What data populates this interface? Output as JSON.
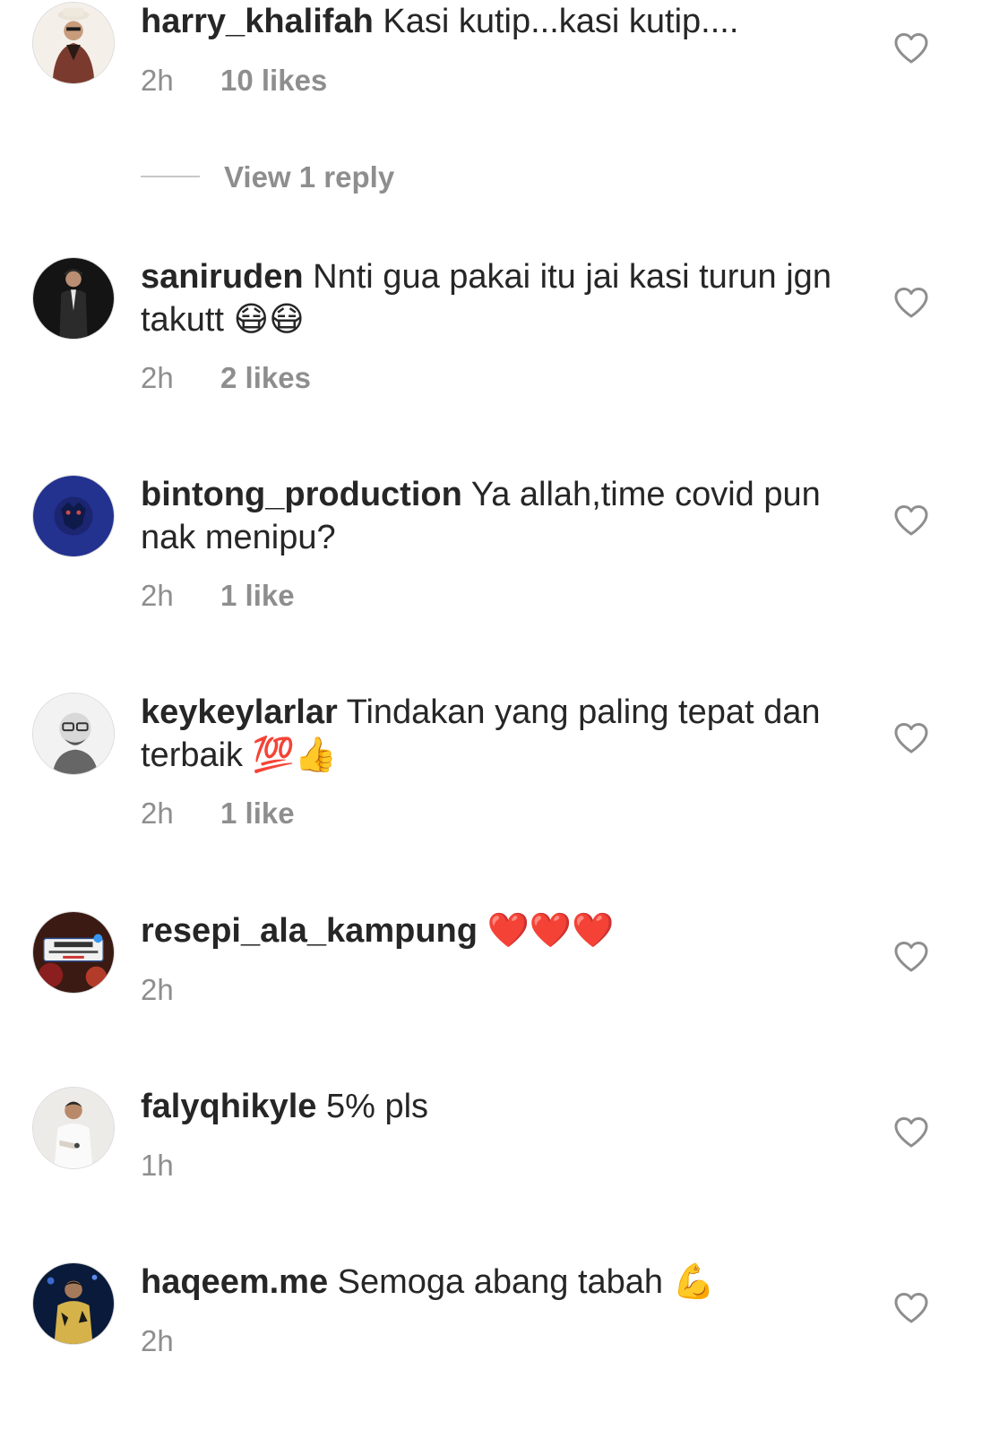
{
  "reply_link": {
    "label": "View 1 reply"
  },
  "comments": [
    {
      "username": "harry_khalifah",
      "text": "Kasi kutip...kasi kutip....",
      "time": "2h",
      "likes": "10 likes",
      "avatar_color": "#7a3b2e",
      "avatar_bg": "#f4efe9"
    },
    {
      "username": "saniruden",
      "text": "Nnti gua pakai itu jai kasi turun jgn takutt 😷😷",
      "time": "2h",
      "likes": "2 likes",
      "avatar_color": "#2b2b2b",
      "avatar_bg": "#111111"
    },
    {
      "username": "bintong_production",
      "text": "Ya allah,time covid pun nak menipu?",
      "time": "2h",
      "likes": "1 like",
      "avatar_color": "#1e3a8a",
      "avatar_bg": "#23318f"
    },
    {
      "username": "keykeylarlar",
      "text": "Tindakan yang paling tepat dan terbaik 💯👍",
      "time": "2h",
      "likes": "1 like",
      "avatar_color": "#444444",
      "avatar_bg": "#f2f2f2"
    },
    {
      "username": "resepi_ala_kampung",
      "text": "❤️❤️❤️",
      "time": "2h",
      "likes": "",
      "avatar_color": "#8b1e1e",
      "avatar_bg": "#3a1a12"
    },
    {
      "username": "falyqhikyle",
      "text": "5% pls",
      "time": "1h",
      "likes": "",
      "avatar_color": "#d9d2c8",
      "avatar_bg": "#ecebe8"
    },
    {
      "username": "haqeem.me",
      "text": "Semoga abang tabah 💪",
      "time": "2h",
      "likes": "",
      "avatar_color": "#d6b24a",
      "avatar_bg": "#0a1a3a"
    }
  ],
  "icons": {
    "heart": "heart-outline-icon",
    "heart_color": "#8e8e8e"
  }
}
